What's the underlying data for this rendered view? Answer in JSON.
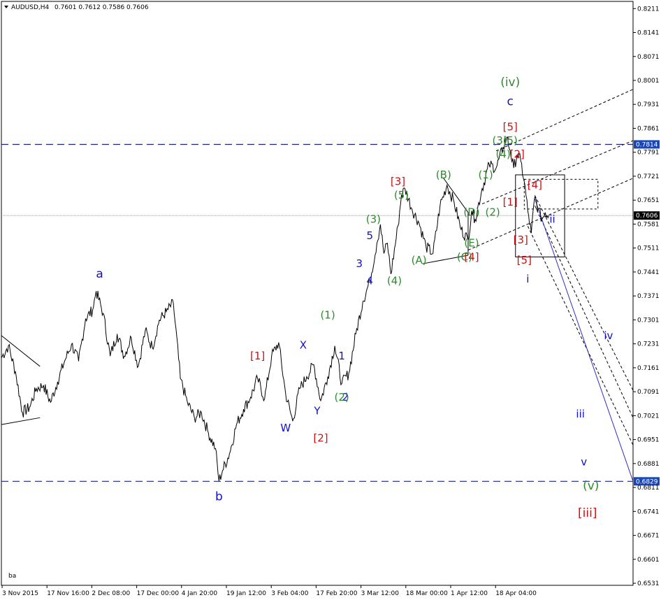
{
  "header": {
    "symbol": "AUDUSD,H4",
    "ohlc": "0.7601 0.7612 0.7586 0.7606"
  },
  "footer_label": "ba",
  "colors": {
    "background": "#ffffff",
    "price_line": "#000000",
    "level_line": "#1a237e",
    "current_box": "#000000",
    "level_box": "#1a47b8",
    "wave_blue": "#1010c8",
    "wave_green": "#2e8b2e",
    "wave_red": "#d01010",
    "channel": "#000000",
    "projection": "#3030c0"
  },
  "chart_data": {
    "type": "line",
    "title": "AUDUSD,H4",
    "x_ticks": [
      "3 Nov 2015",
      "17 Nov 16:00",
      "2 Dec 08:00",
      "17 Dec 00:00",
      "4 Jan 20:00",
      "19 Jan 12:00",
      "3 Feb 04:00",
      "17 Feb 20:00",
      "3 Mar 12:00",
      "18 Mar 00:00",
      "1 Apr 12:00",
      "18 Apr 04:00"
    ],
    "y_ticks": [
      "0.8211",
      "0.8141",
      "0.8071",
      "0.8001",
      "0.7931",
      "0.7861",
      "0.7791",
      "0.7721",
      "0.7651",
      "0.7581",
      "0.7511",
      "0.7441",
      "0.7371",
      "0.7301",
      "0.7231",
      "0.7161",
      "0.7091",
      "0.7021",
      "0.6951",
      "0.6881",
      "0.6811",
      "0.6741",
      "0.6671",
      "0.6601",
      "0.6531"
    ],
    "ylim": [
      0.6525,
      0.8232
    ],
    "x_range": [
      0,
      180
    ],
    "current_price": "0.7606",
    "levels": [
      {
        "label": "0.7814",
        "value": 0.7814,
        "style": "dashed"
      },
      {
        "label": "0.6829",
        "value": 0.6829,
        "style": "dashed"
      }
    ],
    "series": [
      {
        "type": "line",
        "points": [
          [
            0,
            0.719
          ],
          [
            2,
            0.7225
          ],
          [
            4,
            0.715
          ],
          [
            6,
            0.703
          ],
          [
            8,
            0.7045
          ],
          [
            10,
            0.71
          ],
          [
            12,
            0.711
          ],
          [
            14,
            0.706
          ],
          [
            16,
            0.712
          ],
          [
            18,
            0.718
          ],
          [
            20,
            0.723
          ],
          [
            22,
            0.718
          ],
          [
            24,
            0.7305
          ],
          [
            26,
            0.733
          ],
          [
            27,
            0.7385
          ],
          [
            29,
            0.732
          ],
          [
            31,
            0.7195
          ],
          [
            33,
            0.726
          ],
          [
            35,
            0.7195
          ],
          [
            37,
            0.725
          ],
          [
            39,
            0.7165
          ],
          [
            41,
            0.727
          ],
          [
            43,
            0.722
          ],
          [
            45,
            0.73
          ],
          [
            47,
            0.7325
          ],
          [
            49,
            0.735
          ],
          [
            51,
            0.713
          ],
          [
            53,
            0.706
          ],
          [
            55,
            0.7015
          ],
          [
            57,
            0.703
          ],
          [
            59,
            0.697
          ],
          [
            61,
            0.6925
          ],
          [
            62,
            0.683
          ],
          [
            63,
            0.686
          ],
          [
            65,
            0.691
          ],
          [
            67,
            0.6995
          ],
          [
            69,
            0.704
          ],
          [
            71,
            0.7075
          ],
          [
            73,
            0.713
          ],
          [
            75,
            0.707
          ],
          [
            77,
            0.7195
          ],
          [
            79,
            0.7235
          ],
          [
            81,
            0.7085
          ],
          [
            83,
            0.7005
          ],
          [
            85,
            0.71
          ],
          [
            87,
            0.7135
          ],
          [
            89,
            0.717
          ],
          [
            91,
            0.7065
          ],
          [
            93,
            0.7135
          ],
          [
            95,
            0.7225
          ],
          [
            97,
            0.7115
          ],
          [
            99,
            0.7145
          ],
          [
            101,
            0.726
          ],
          [
            103,
            0.7355
          ],
          [
            105,
            0.7415
          ],
          [
            107,
            0.7525
          ],
          [
            108,
            0.758
          ],
          [
            109,
            0.7495
          ],
          [
            110,
            0.7525
          ],
          [
            111,
            0.7435
          ],
          [
            113,
            0.7575
          ],
          [
            114,
            0.7665
          ],
          [
            115,
            0.7685
          ],
          [
            117,
            0.7625
          ],
          [
            119,
            0.7585
          ],
          [
            121,
            0.7515
          ],
          [
            123,
            0.7495
          ],
          [
            125,
            0.7635
          ],
          [
            127,
            0.7695
          ],
          [
            129,
            0.7645
          ],
          [
            131,
            0.7565
          ],
          [
            133,
            0.7535
          ],
          [
            134,
            0.762
          ],
          [
            135,
            0.7595
          ],
          [
            137,
            0.7685
          ],
          [
            139,
            0.7755
          ],
          [
            141,
            0.7745
          ],
          [
            143,
            0.7805
          ],
          [
            144,
            0.7835
          ],
          [
            145,
            0.7795
          ],
          [
            146,
            0.7745
          ],
          [
            147,
            0.7785
          ],
          [
            148,
            0.7765
          ],
          [
            149,
            0.7705
          ],
          [
            150,
            0.762
          ],
          [
            151,
            0.7555
          ],
          [
            152,
            0.766
          ],
          [
            153,
            0.7625
          ],
          [
            154,
            0.7595
          ],
          [
            155,
            0.7615
          ],
          [
            156,
            0.7606
          ]
        ]
      }
    ],
    "wave_labels": [
      {
        "text": "a",
        "x": 28,
        "y": 0.7425,
        "color": "wave_blue"
      },
      {
        "text": "b",
        "x": 62,
        "y": 0.6773,
        "color": "wave_blue"
      },
      {
        "text": "W",
        "x": 81,
        "y": 0.6975,
        "color": "wave_blue"
      },
      {
        "text": "X",
        "x": 86,
        "y": 0.7217,
        "color": "wave_blue"
      },
      {
        "text": "Y",
        "x": 90,
        "y": 0.7025,
        "color": "wave_blue"
      },
      {
        "text": "1",
        "x": 97,
        "y": 0.7185,
        "color": "wave_blue"
      },
      {
        "text": "2",
        "x": 98,
        "y": 0.7065,
        "color": "wave_blue"
      },
      {
        "text": "3",
        "x": 102,
        "y": 0.7455,
        "color": "wave_blue"
      },
      {
        "text": "4",
        "x": 105,
        "y": 0.7405,
        "color": "wave_blue"
      },
      {
        "text": "5",
        "x": 105,
        "y": 0.7537,
        "color": "wave_blue"
      },
      {
        "text": "c",
        "x": 145,
        "y": 0.7928,
        "color": "wave_blue"
      },
      {
        "text": "i",
        "x": 150,
        "y": 0.741,
        "color": "wave_blue"
      },
      {
        "text": "ii",
        "x": 157,
        "y": 0.7585,
        "color": "wave_blue"
      },
      {
        "text": "iii",
        "x": 165,
        "y": 0.7016,
        "color": "wave_blue"
      },
      {
        "text": "iv",
        "x": 173,
        "y": 0.7245,
        "color": "wave_blue"
      },
      {
        "text": "v",
        "x": 166,
        "y": 0.6876,
        "color": "wave_blue"
      },
      {
        "text": "[1]",
        "x": 73,
        "y": 0.7185,
        "color": "wave_red"
      },
      {
        "text": "[2]",
        "x": 91,
        "y": 0.6945,
        "color": "wave_red"
      },
      {
        "text": "[3]",
        "x": 113,
        "y": 0.7695,
        "color": "wave_red"
      },
      {
        "text": "[4]",
        "x": 134,
        "y": 0.7475,
        "color": "wave_red"
      },
      {
        "text": "[5]",
        "x": 145,
        "y": 0.7855,
        "color": "wave_red"
      },
      {
        "text": "[1]",
        "x": 145,
        "y": 0.7635,
        "color": "wave_red"
      },
      {
        "text": "[2]",
        "x": 147,
        "y": 0.7775,
        "color": "wave_red"
      },
      {
        "text": "[3]",
        "x": 148,
        "y": 0.7525,
        "color": "wave_red"
      },
      {
        "text": "[4]",
        "x": 152,
        "y": 0.7685,
        "color": "wave_red"
      },
      {
        "text": "[5]",
        "x": 149,
        "y": 0.7465,
        "color": "wave_red"
      },
      {
        "text": "[iii]",
        "x": 167,
        "y": 0.6725,
        "color": "wave_red"
      },
      {
        "text": "(1)",
        "x": 93,
        "y": 0.7305,
        "color": "wave_green"
      },
      {
        "text": "(2)",
        "x": 97,
        "y": 0.7065,
        "color": "wave_green"
      },
      {
        "text": "(3)",
        "x": 106,
        "y": 0.7585,
        "color": "wave_green"
      },
      {
        "text": "(4)",
        "x": 112,
        "y": 0.7405,
        "color": "wave_green"
      },
      {
        "text": "(5)",
        "x": 114,
        "y": 0.7655,
        "color": "wave_green"
      },
      {
        "text": "(A)",
        "x": 119,
        "y": 0.7465,
        "color": "wave_green"
      },
      {
        "text": "(B)",
        "x": 126,
        "y": 0.7715,
        "color": "wave_green"
      },
      {
        "text": "(C)",
        "x": 132,
        "y": 0.7475,
        "color": "wave_green"
      },
      {
        "text": "(D)",
        "x": 134,
        "y": 0.7605,
        "color": "wave_green"
      },
      {
        "text": "(E)",
        "x": 134,
        "y": 0.7515,
        "color": "wave_green"
      },
      {
        "text": "(1)",
        "x": 138,
        "y": 0.7715,
        "color": "wave_green"
      },
      {
        "text": "(2)",
        "x": 140,
        "y": 0.7605,
        "color": "wave_green"
      },
      {
        "text": "(3)",
        "x": 142,
        "y": 0.7815,
        "color": "wave_green"
      },
      {
        "text": "(4)",
        "x": 143,
        "y": 0.7775,
        "color": "wave_green"
      },
      {
        "text": "(5)",
        "x": 145,
        "y": 0.7815,
        "color": "wave_green"
      },
      {
        "text": "(iv)",
        "x": 145,
        "y": 0.7985,
        "color": "wave_green"
      },
      {
        "text": "(v)",
        "x": 168,
        "y": 0.6805,
        "color": "wave_green"
      }
    ]
  }
}
